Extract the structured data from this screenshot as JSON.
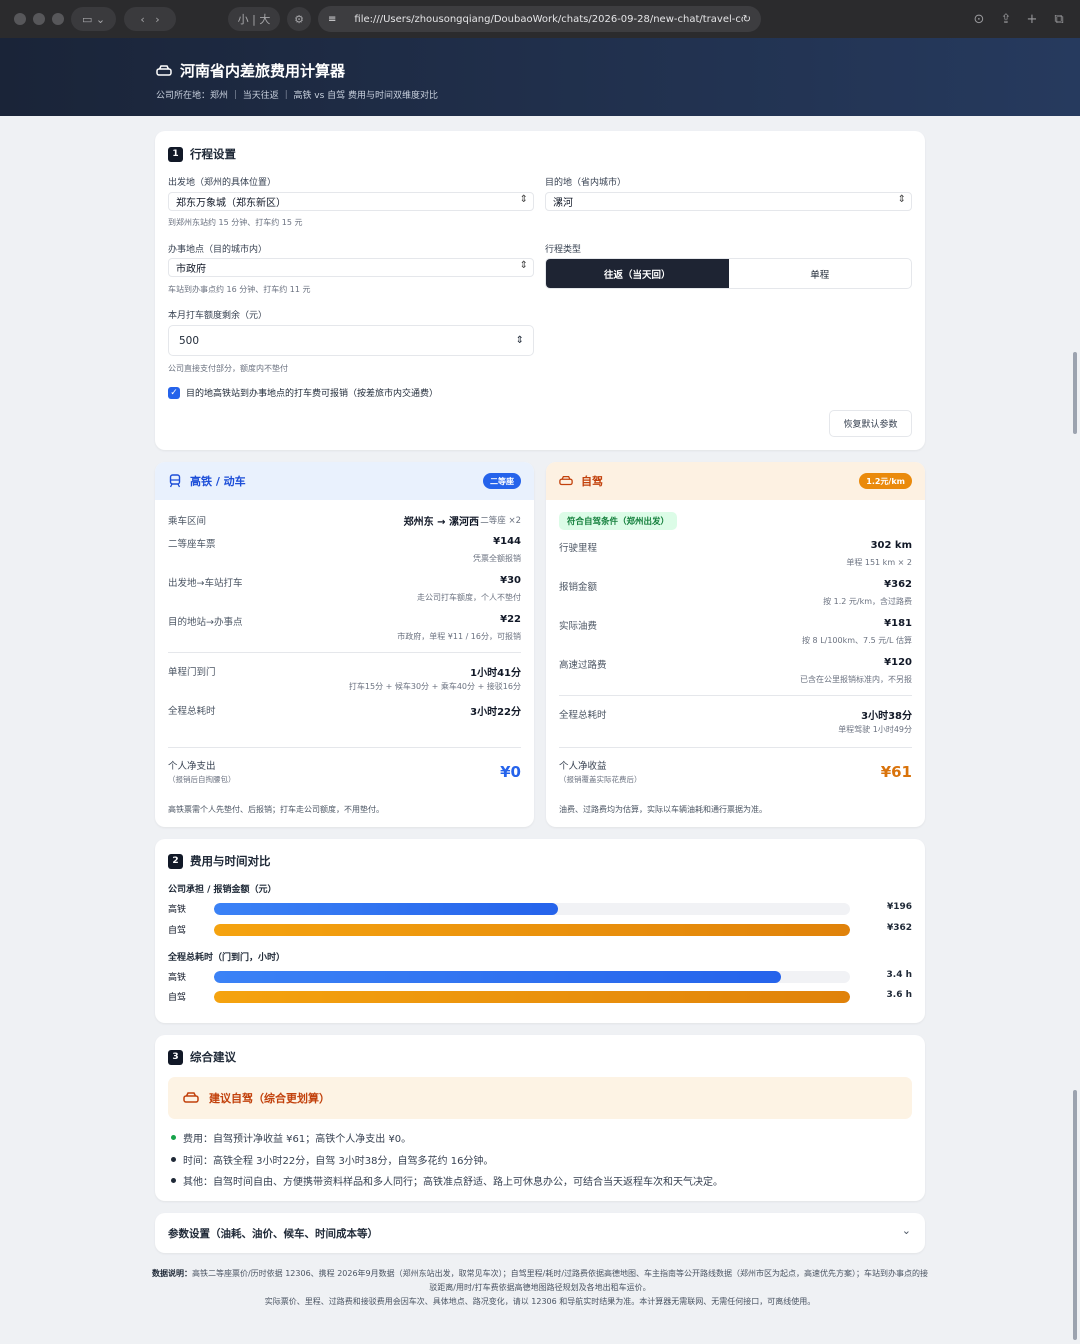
{
  "browser": {
    "url": "file:///Users/zhousongqiang/DoubaoWork/chats/2026-09-28/new-chat/travel-cost-ca",
    "font_small": "小",
    "font_large": "大"
  },
  "hero": {
    "title": "河南省内差旅费用计算器",
    "subtitle": "公司所在地：郑州 ｜ 当天往返 ｜ 高铁 vs 自驾 费用与时间双维度对比"
  },
  "trip": {
    "section_no": "1",
    "title": "行程设置",
    "origin_label": "出发地（郑州的具体位置）",
    "origin_value": "郑东万象城（郑东新区）",
    "origin_hint": "到郑州东站约 15 分钟、打车约 15 元",
    "dest_label": "目的地（省内城市）",
    "dest_value": "漯河",
    "office_label": "办事地点（目的城市内）",
    "office_value": "市政府",
    "office_hint": "车站到办事点约 16 分钟、打车约 11 元",
    "type_label": "行程类型",
    "type_options": [
      "往返（当天回）",
      "单程"
    ],
    "taxi_label": "本月打车额度剩余（元）",
    "taxi_value": "500",
    "taxi_hint": "公司直接支付部分，额度内不垫付",
    "checkbox_label": "目的地高铁站到办事地点的打车费可报销（按差旅市内交通费）",
    "reset_label": "恢复默认参数"
  },
  "rail": {
    "title": "高铁 / 动车",
    "badge": "二等座",
    "route_k": "乘车区间",
    "route_v": "郑州东 → 漯河西",
    "route_note": "二等座 ×2",
    "ticket_k": "二等座车票",
    "ticket_v": "¥144",
    "ticket_n": "凭票全额报销",
    "taxi1_k": "出发地→车站打车",
    "taxi1_v": "¥30",
    "taxi1_n": "走公司打车额度，个人不垫付",
    "taxi2_k": "目的地站→办事点",
    "taxi2_v": "¥22",
    "taxi2_n": "市政府，单程 ¥11 / 16分，可报销",
    "d2d_k": "单程门到门",
    "d2d_v": "1小时41分",
    "d2d_n": "打车15分 + 候车30分 + 乘车40分 + 接驳16分",
    "total_k": "全程总耗时",
    "total_v": "3小时22分",
    "net_k": "个人净支出",
    "net_sub": "（报销后自掏腰包）",
    "net_v": "¥0",
    "foot": "高铁票需个人先垫付、后报销；打车走公司额度，不用垫付。"
  },
  "car": {
    "title": "自驾",
    "badge": "1.2元/km",
    "ok": "符合自驾条件（郑州出发）",
    "dist_k": "行驶里程",
    "dist_v": "302 km",
    "dist_n": "单程 151 km × 2",
    "reimb_k": "报销金额",
    "reimb_v": "¥362",
    "reimb_n": "按 1.2 元/km，含过路费",
    "fuel_k": "实际油费",
    "fuel_v": "¥181",
    "fuel_n": "按 8 L/100km、7.5 元/L 估算",
    "toll_k": "高速过路费",
    "toll_v": "¥120",
    "toll_n": "已含在公里报销标准内，不另报",
    "total_k": "全程总耗时",
    "total_v": "3小时38分",
    "total_n": "单程驾驶 1小时49分",
    "net_k": "个人净收益",
    "net_sub": "（报销覆盖实际花费后）",
    "net_v": "¥61",
    "foot": "油费、过路费均为估算，实际以车辆油耗和通行票据为准。"
  },
  "compare": {
    "section_no": "2",
    "title": "费用与时间对比",
    "cost_title": "公司承担 / 报销金额（元）",
    "time_title": "全程总耗时（门到门，小时）",
    "rail_label": "高铁",
    "car_label": "自驾",
    "cost_rail": 196,
    "cost_car": 362,
    "cost_rail_text": "¥196",
    "cost_car_text": "¥362",
    "time_rail": 3.4,
    "time_car": 3.6,
    "time_rail_text": "3.4 h",
    "time_car_text": "3.6 h"
  },
  "advice": {
    "section_no": "3",
    "title": "综合建议",
    "banner": "建议自驾（综合更划算）",
    "b1": "费用：自驾预计净收益 ¥61；高铁个人净支出 ¥0。",
    "b2": "时间：高铁全程 3小时22分，自驾 3小时38分，自驾多花约 16分钟。",
    "b3": "其他：自驾时间自由、方便携带资料样品和多人同行；高铁准点舒适、路上可休息办公，可结合当天返程车次和天气决定。"
  },
  "params": {
    "title": "参数设置（油耗、油价、候车、时间成本等）"
  },
  "footer": {
    "lead": "数据说明：",
    "line1": "高铁二等座票价/历时依据 12306、携程 2026年9月数据（郑州东站出发，取常见车次）；自驾里程/耗时/过路费依据高德地图、车主指南等公开路线数据（郑州市区为起点，高速优先方案）；车站到办事点的接驳距离/用时/打车费依据高德地图路径规划及各地出租车运价。",
    "line2": "实际票价、里程、过路费和接驳费用会因车次、具体地点、路况变化，请以 12306 和导航实时结果为准。本计算器无需联网、无需任何接口，可离线使用。"
  },
  "colors": {
    "rail_blue": "#2563eb",
    "car_orange": "#ea8a0c"
  }
}
